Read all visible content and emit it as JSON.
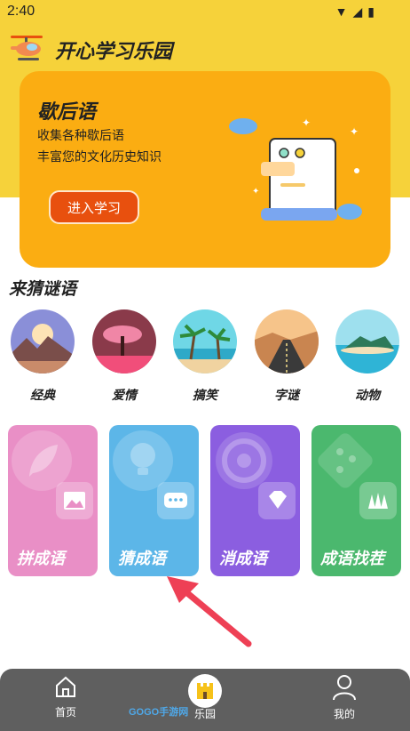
{
  "status_bar": {
    "time": "2:40"
  },
  "app": {
    "title": "开心学习乐园"
  },
  "banner": {
    "title": "歇后语",
    "line1": "收集各种歇后语",
    "line2": "丰富您的文化历史知识",
    "button": "进入学习"
  },
  "riddles": {
    "title": "来猜谜语",
    "categories": [
      {
        "label": "经典",
        "icon": "mountain-sunset-icon"
      },
      {
        "label": "爱情",
        "icon": "pink-tree-icon"
      },
      {
        "label": "搞笑",
        "icon": "beach-palm-icon"
      },
      {
        "label": "字谜",
        "icon": "desert-road-icon"
      },
      {
        "label": "动物",
        "icon": "island-icon"
      }
    ]
  },
  "games": [
    {
      "label": "拼成语",
      "color": "#e98fc6",
      "icon": "feather-icon",
      "badge": "image-icon"
    },
    {
      "label": "猜成语",
      "color": "#5cb6e8",
      "icon": "lightbulb-icon",
      "badge": "chat-icon"
    },
    {
      "label": "消成语",
      "color": "#8b5ee0",
      "icon": "target-icon",
      "badge": "gem-icon"
    },
    {
      "label": "成语找茬",
      "color": "#4bb86e",
      "icon": "git-branch-icon",
      "badge": "forest-icon"
    }
  ],
  "nav": {
    "home": "首页",
    "park": "乐园",
    "mine": "我的"
  },
  "watermark": "GOGO手游网",
  "colors": {
    "header": "#f6d23a",
    "banner": "#fbad12",
    "button": "#e8500e",
    "nav": "#5f5f5f",
    "arrow": "#ee4055"
  }
}
